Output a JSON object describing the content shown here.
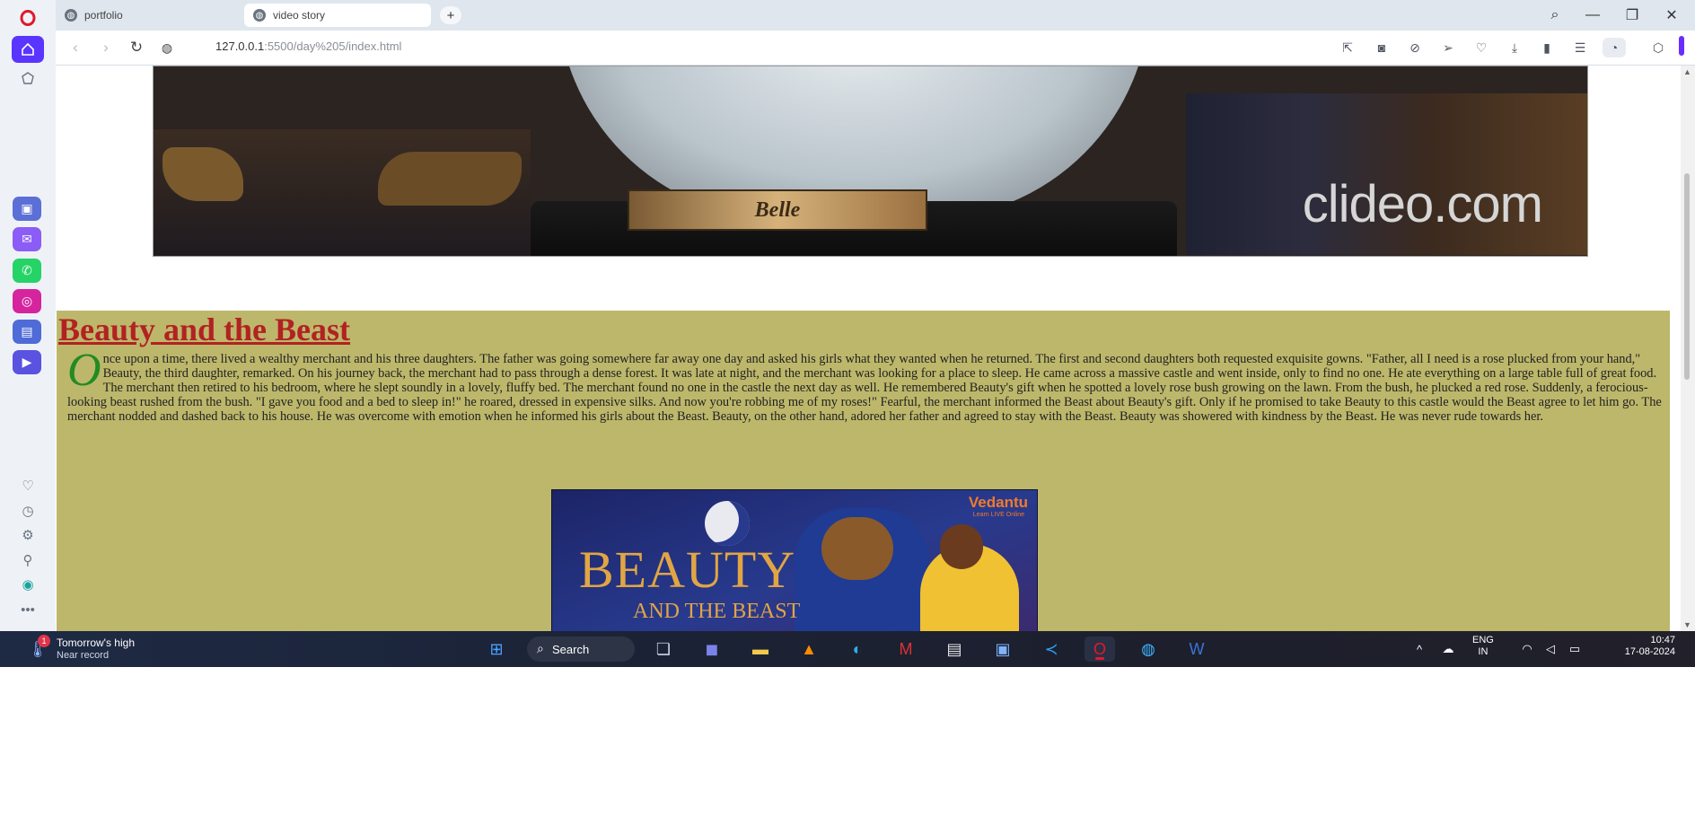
{
  "browser": {
    "tabs": [
      {
        "label": "portfolio",
        "active": false
      },
      {
        "label": "video story",
        "active": true
      }
    ],
    "new_tab": "+",
    "url_host": "127.0.0.1",
    "url_path": ":5500/day%205/index.html",
    "window_controls": {
      "search": "⌕",
      "minimize": "—",
      "restore": "❐",
      "close": "✕"
    }
  },
  "page": {
    "video_overlay": {
      "plaque_text": "Belle",
      "watermark": "clideo.com"
    },
    "story": {
      "title": "Beauty and the Beast",
      "drop_cap": "O",
      "body": "nce upon a time, there lived a wealthy merchant and his three daughters. The father was going somewhere far away one day and asked his girls what they wanted when he returned. The first and second daughters both requested exquisite gowns. \"Father, all I need is a rose plucked from your hand,\" Beauty, the third daughter, remarked. On his journey back, the merchant had to pass through a dense forest. It was late at night, and the merchant was looking for a place to sleep. He came across a massive castle and went inside, only to find no one. He ate everything on a large table full of great food. The merchant then retired to his bedroom, where he slept soundly in a lovely, fluffy bed. The merchant found no one in the castle the next day as well. He remembered Beauty's gift when he spotted a lovely rose bush growing on the lawn. From the bush, he plucked a red rose. Suddenly, a ferocious-looking beast rushed from the bush. \"I gave you food and a bed to sleep in!\" he roared, dressed in expensive silks. And now you're robbing me of my roses!\" Fearful, the merchant informed the Beast about Beauty's gift. Only if he promised to take Beauty to this castle would the Beast agree to let him go. The merchant nodded and dashed back to his house. He was overcome with emotion when he informed his girls about the Beast. Beauty, on the other hand, adored her father and agreed to stay with the Beast. Beauty was showered with kindness by the Beast. He was never rude towards her.",
      "poster": {
        "title": "BEAUTY",
        "subtitle": "AND THE BEAST",
        "brand": "Vedantu",
        "brand_sub": "Learn LIVE Online"
      }
    }
  },
  "taskbar": {
    "weather_title": "Tomorrow's high",
    "weather_sub": "Near record",
    "weather_badge": "1",
    "search_label": "Search",
    "lang_line1": "ENG",
    "lang_line2": "IN",
    "time": "10:47",
    "date": "17-08-2024"
  },
  "colors": {
    "story_bg": "#bdb76b",
    "title": "#b22222",
    "drop_cap": "#228b22",
    "opera_red": "#e0192d",
    "sidebar_accent": "#6a2cff"
  }
}
